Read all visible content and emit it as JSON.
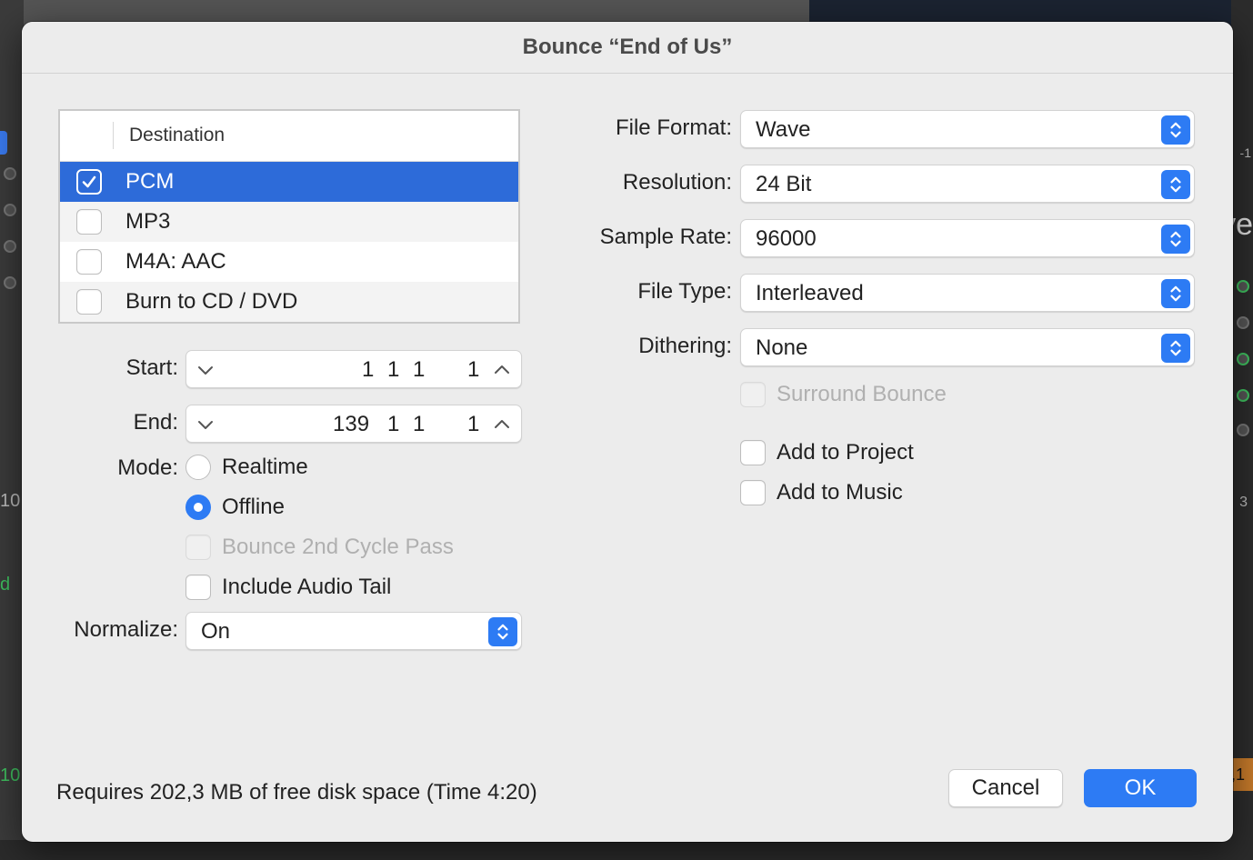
{
  "background": {
    "left_number": "10",
    "left_number2": "10,",
    "left_letter": "d",
    "right_number": "-1",
    "right_letter": "ve",
    "right_number2": "3",
    "right_number3": ",1",
    "ruler_mark": "3"
  },
  "dialog": {
    "title": "Bounce “End of Us”"
  },
  "destination": {
    "header": "Destination",
    "items": [
      {
        "label": "PCM",
        "checked": true
      },
      {
        "label": "MP3",
        "checked": false
      },
      {
        "label": "M4A: AAC",
        "checked": false
      },
      {
        "label": "Burn to CD / DVD",
        "checked": false
      }
    ]
  },
  "range": {
    "start_label": "Start:",
    "start": {
      "bar": "1",
      "beat": "1",
      "div": "1",
      "tick": "1"
    },
    "end_label": "End:",
    "end": {
      "bar": "139",
      "beat": "1",
      "div": "1",
      "tick": "1"
    }
  },
  "mode": {
    "label": "Mode:",
    "realtime": "Realtime",
    "offline": "Offline",
    "selected": "Offline",
    "bounce_2nd_cycle": "Bounce 2nd Cycle Pass",
    "include_audio_tail": "Include Audio Tail"
  },
  "normalize": {
    "label": "Normalize:",
    "value": "On"
  },
  "format": {
    "file_format_label": "File Format:",
    "file_format": "Wave",
    "resolution_label": "Resolution:",
    "resolution": "24 Bit",
    "sample_rate_label": "Sample Rate:",
    "sample_rate": "96000",
    "file_type_label": "File Type:",
    "file_type": "Interleaved",
    "dithering_label": "Dithering:",
    "dithering": "None",
    "surround_bounce": "Surround Bounce",
    "add_to_project": "Add to Project",
    "add_to_music": "Add to Music"
  },
  "footer": {
    "requirements": "Requires 202,3 MB of free disk space  (Time 4:20)",
    "cancel": "Cancel",
    "ok": "OK"
  },
  "colors": {
    "accent": "#2d7bf4",
    "selection": "#2d6bd9"
  }
}
